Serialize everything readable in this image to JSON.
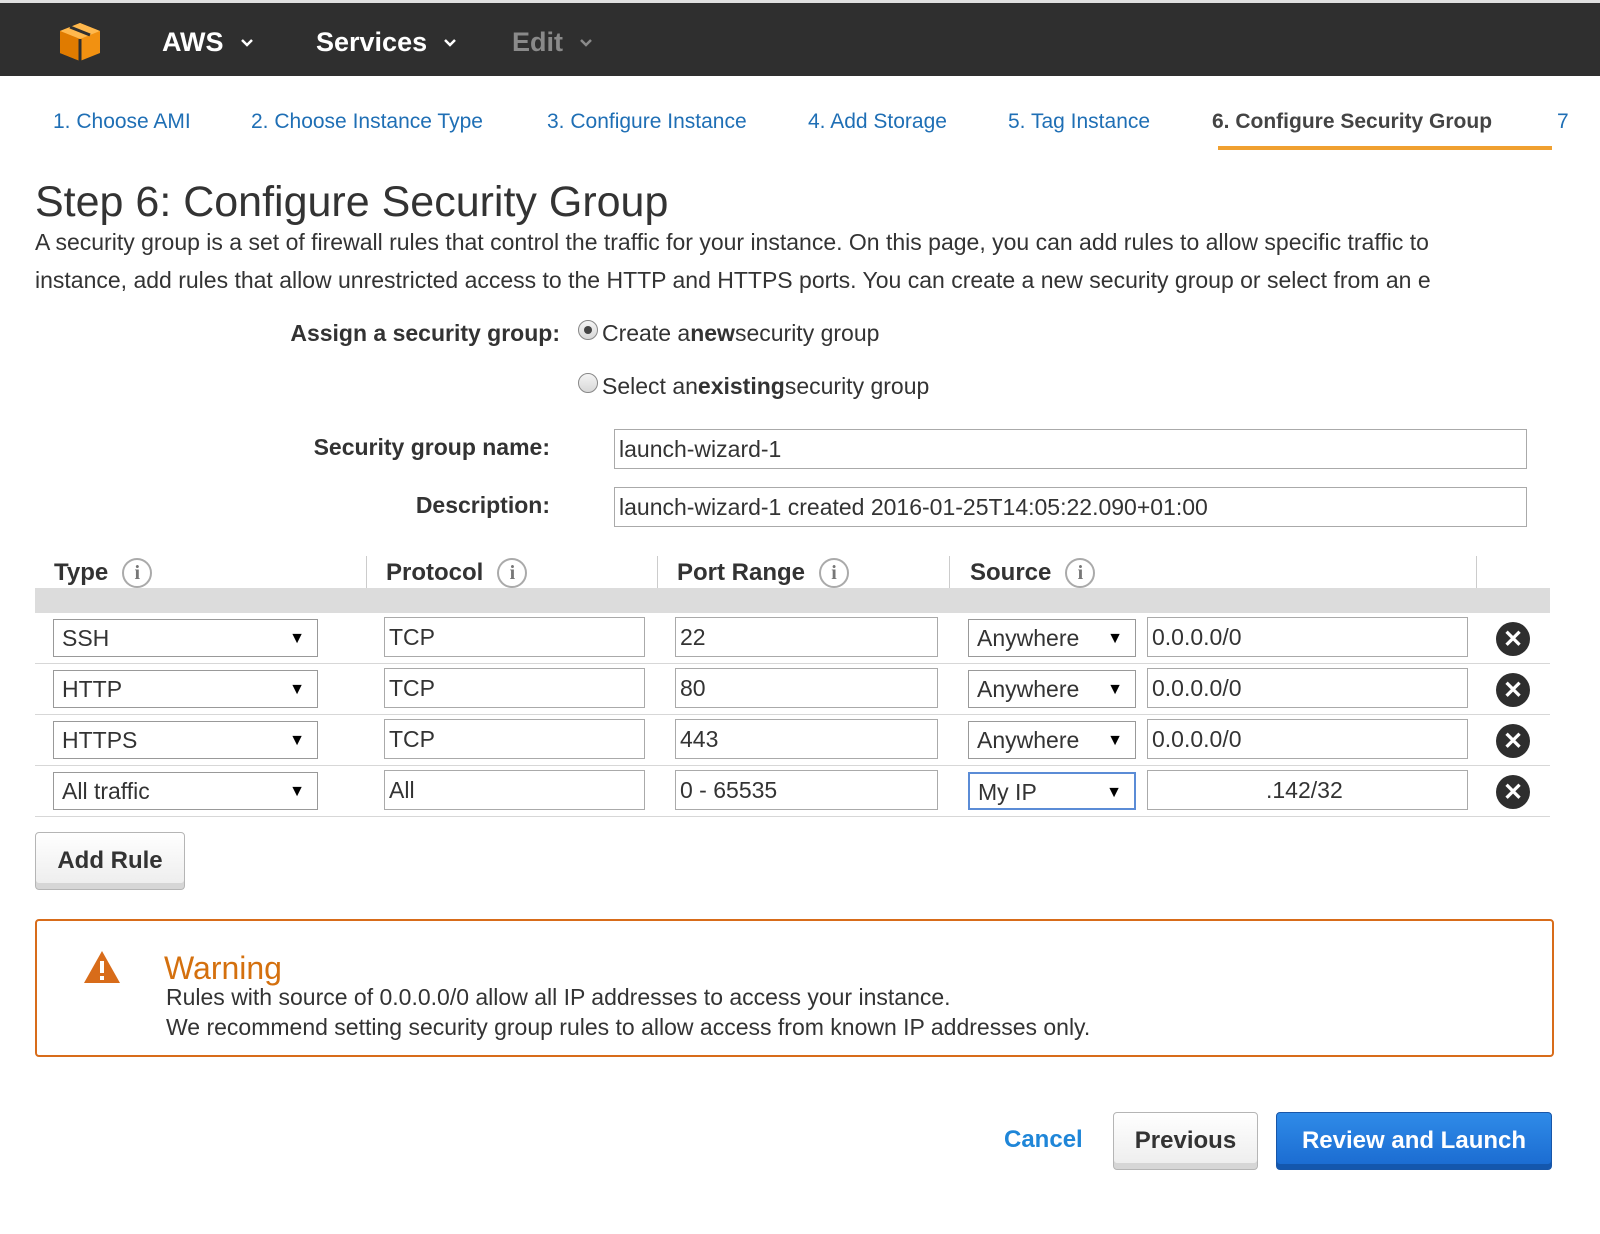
{
  "topbar": {
    "logo": "aws-cube-icon",
    "menus": [
      {
        "label": "AWS",
        "disabled": false
      },
      {
        "label": "Services",
        "disabled": false
      },
      {
        "label": "Edit",
        "disabled": true
      }
    ]
  },
  "steps": [
    {
      "label": "1. Choose AMI",
      "active": false
    },
    {
      "label": "2. Choose Instance Type",
      "active": false
    },
    {
      "label": "3. Configure Instance",
      "active": false
    },
    {
      "label": "4. Add Storage",
      "active": false
    },
    {
      "label": "5. Tag Instance",
      "active": false
    },
    {
      "label": "6. Configure Security Group",
      "active": true
    },
    {
      "label": "7",
      "active": false
    }
  ],
  "page": {
    "title": "Step 6: Configure Security Group",
    "intro_line1": "A security group is a set of firewall rules that control the traffic for your instance. On this page, you can add rules to allow specific traffic to",
    "intro_line2": "instance, add rules that allow unrestricted access to the HTTP and HTTPS ports. You can create a new security group or select from an e"
  },
  "assign": {
    "label": "Assign a security group:",
    "options": [
      {
        "pre": "Create a ",
        "bold": "new",
        "post": " security group",
        "selected": true
      },
      {
        "pre": "Select an ",
        "bold": "existing",
        "post": " security group",
        "selected": false
      }
    ]
  },
  "fields": {
    "name_label": "Security group name:",
    "name_value": "launch-wizard-1",
    "description_label": "Description:",
    "description_value": "launch-wizard-1 created 2016-01-25T14:05:22.090+01:00"
  },
  "table": {
    "headers": [
      "Type",
      "Protocol",
      "Port Range",
      "Source"
    ],
    "info_glyph": "i",
    "rows": [
      {
        "type": "SSH",
        "protocol": "TCP",
        "port": "22",
        "source_mode": "Anywhere",
        "source_cidr": "0.0.0.0/0"
      },
      {
        "type": "HTTP",
        "protocol": "TCP",
        "port": "80",
        "source_mode": "Anywhere",
        "source_cidr": "0.0.0.0/0"
      },
      {
        "type": "HTTPS",
        "protocol": "TCP",
        "port": "443",
        "source_mode": "Anywhere",
        "source_cidr": "0.0.0.0/0"
      },
      {
        "type": "All traffic",
        "protocol": "All",
        "port": "0 - 65535",
        "source_mode": "My IP",
        "source_cidr": ".142/32"
      }
    ],
    "select_arrow": "▼",
    "remove_glyph": "✕"
  },
  "buttons": {
    "add_rule": "Add Rule",
    "cancel": "Cancel",
    "previous": "Previous",
    "review_launch": "Review and Launch"
  },
  "warning": {
    "icon": "warning-triangle-icon",
    "title": "Warning",
    "line1": "Rules with source of 0.0.0.0/0 allow all IP addresses to access your instance.",
    "line2": "We recommend setting security group rules to allow access from known IP addresses only."
  }
}
